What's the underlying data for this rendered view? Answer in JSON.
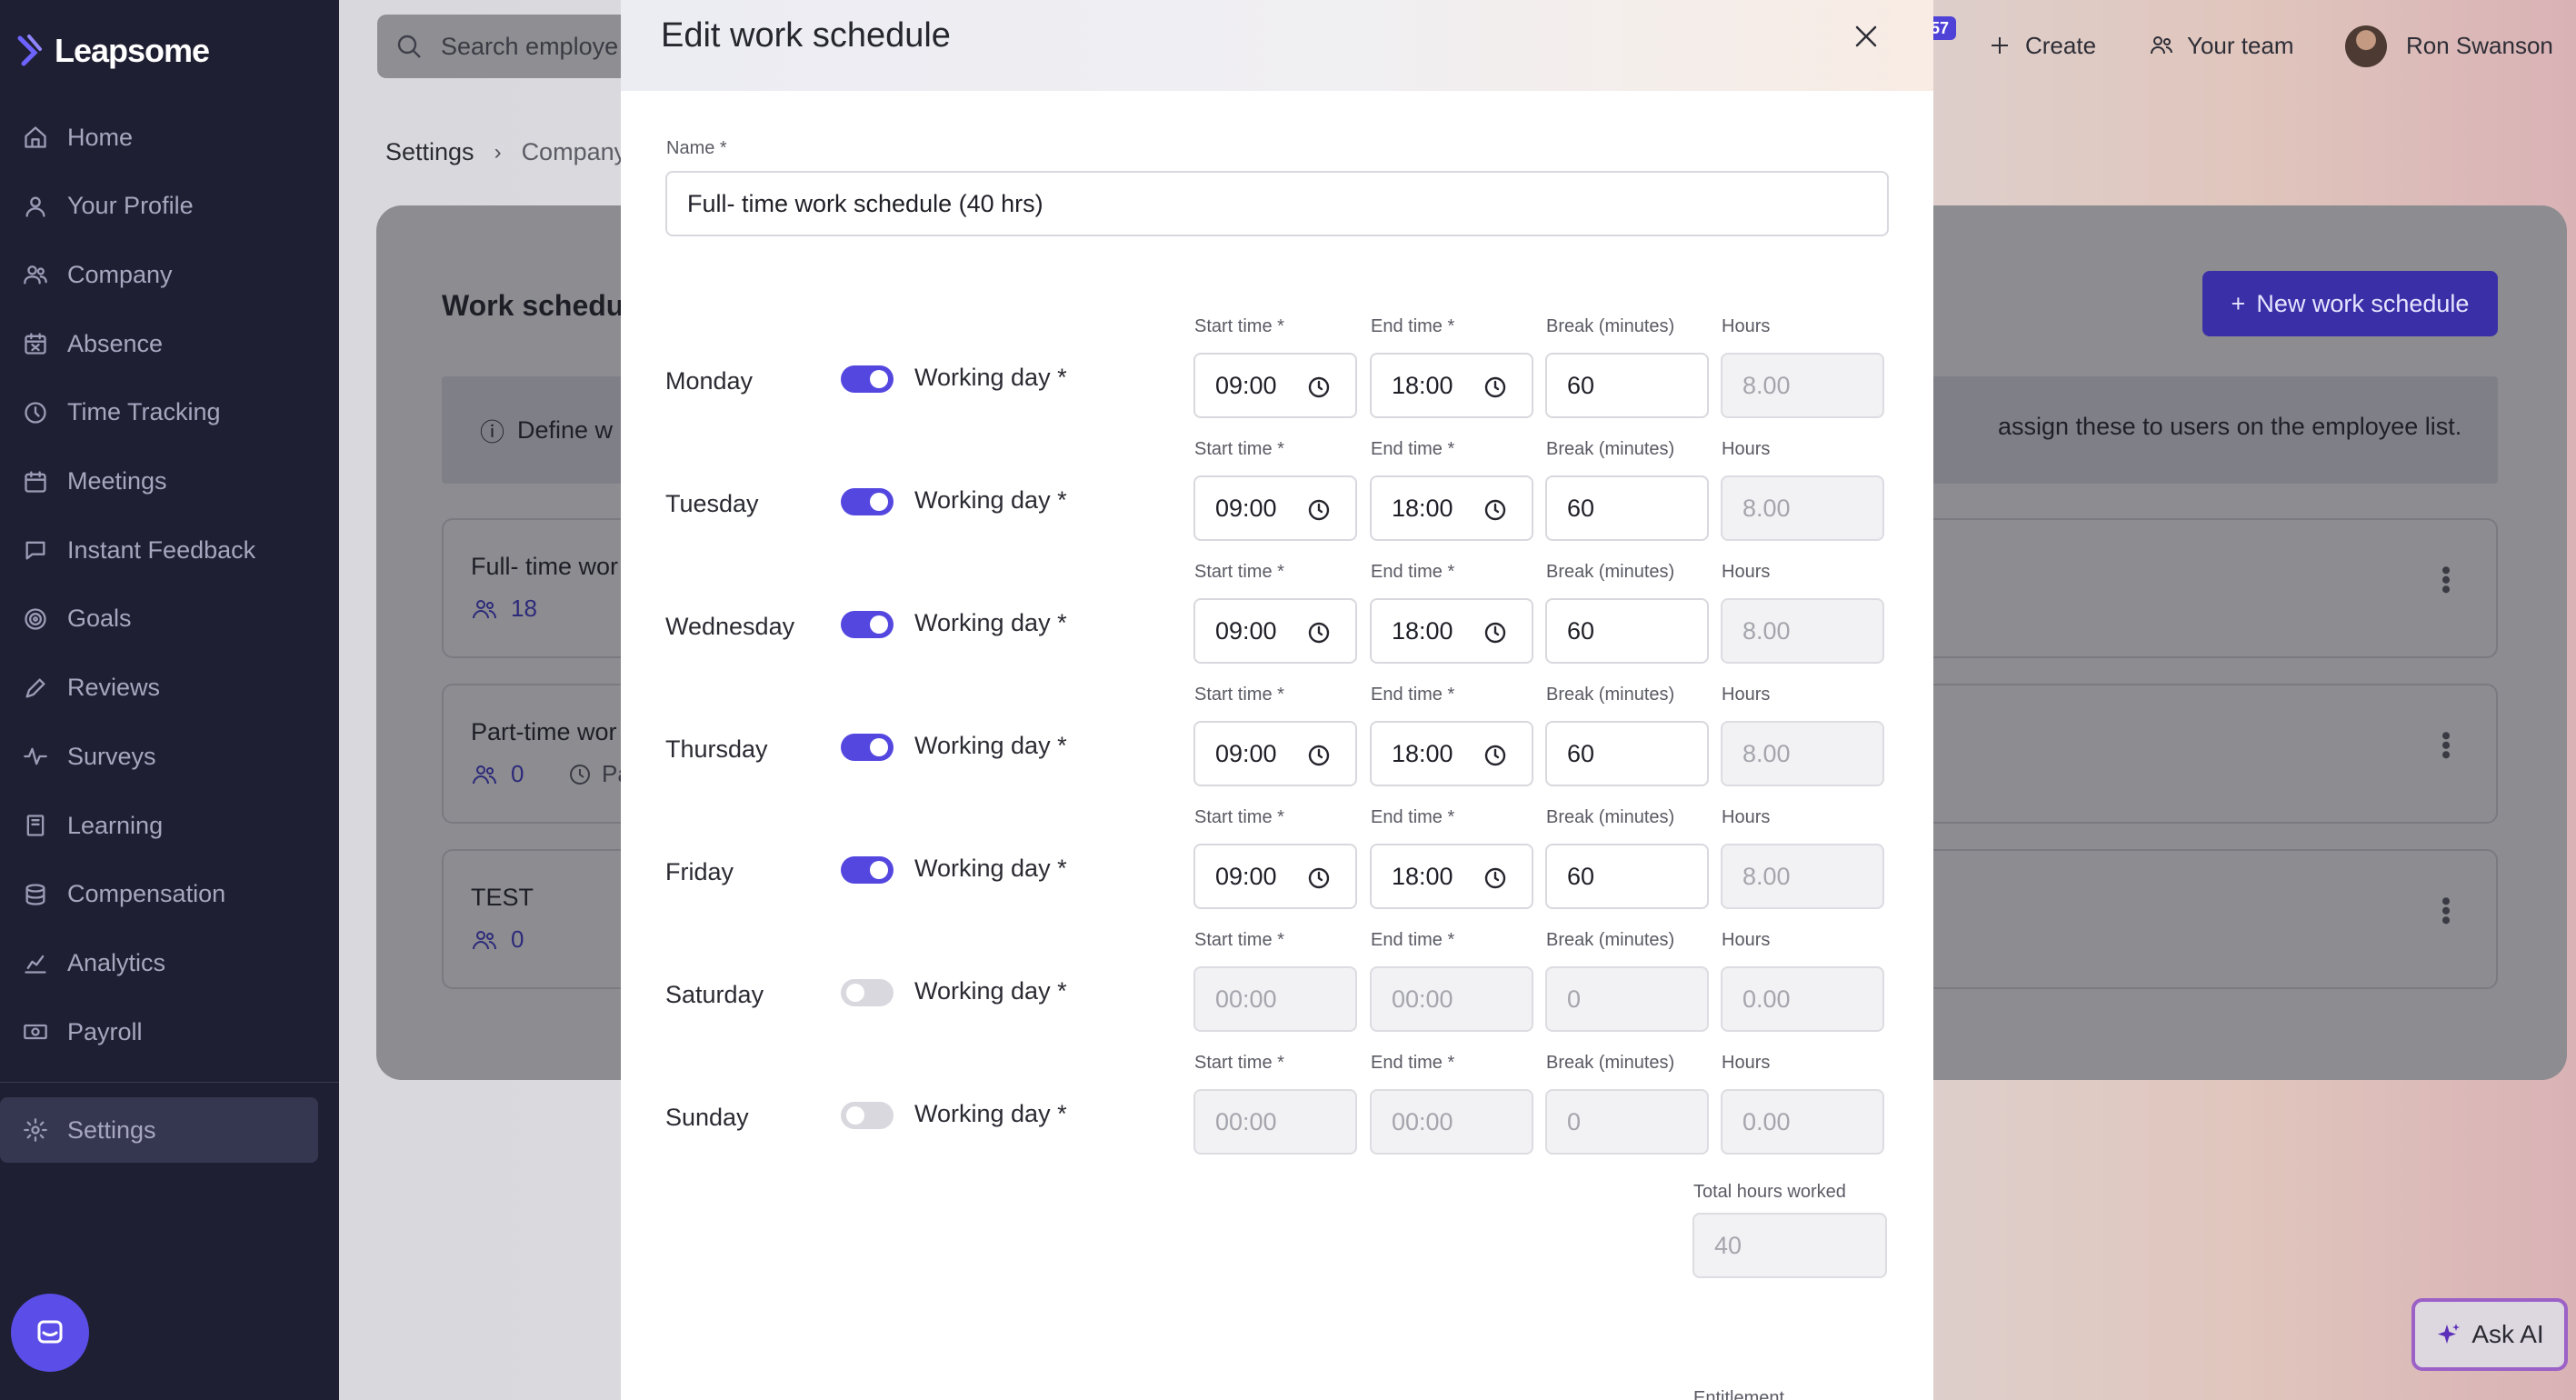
{
  "app": {
    "brand": "Leapsome"
  },
  "sidebar": {
    "items": [
      {
        "label": "Home",
        "icon": "home-icon"
      },
      {
        "label": "Your Profile",
        "icon": "user-icon"
      },
      {
        "label": "Company",
        "icon": "users-icon"
      },
      {
        "label": "Absence",
        "icon": "calendar-x-icon"
      },
      {
        "label": "Time Tracking",
        "icon": "clock-icon"
      },
      {
        "label": "Meetings",
        "icon": "calendar-icon"
      },
      {
        "label": "Instant Feedback",
        "icon": "chat-icon"
      },
      {
        "label": "Goals",
        "icon": "target-icon"
      },
      {
        "label": "Reviews",
        "icon": "pen-icon"
      },
      {
        "label": "Surveys",
        "icon": "pulse-icon"
      },
      {
        "label": "Learning",
        "icon": "book-icon"
      },
      {
        "label": "Compensation",
        "icon": "coins-icon"
      },
      {
        "label": "Analytics",
        "icon": "chart-icon"
      },
      {
        "label": "Payroll",
        "icon": "money-icon"
      }
    ],
    "settings": {
      "label": "Settings",
      "icon": "gear-icon"
    }
  },
  "topbar": {
    "search_placeholder": "Search employe",
    "notifications_count": "57",
    "create_label": "Create",
    "team_label": "Your team",
    "user_name": "Ron Swanson"
  },
  "breadcrumb": {
    "root": "Settings",
    "current": "Company"
  },
  "page": {
    "title": "Work schedu",
    "new_button": "New work schedule",
    "info_left": "Define w",
    "info_right": "assign these to users on the employee list.",
    "cards": [
      {
        "name": "Full- time wor",
        "count": "18",
        "extra": ""
      },
      {
        "name": "Part-time wor",
        "count": "0",
        "extra": "Pa"
      },
      {
        "name": "TEST",
        "count": "0",
        "extra": ""
      }
    ]
  },
  "ask_ai": "Ask AI",
  "modal": {
    "title": "Edit work schedule",
    "name_label": "Name *",
    "name_value": "Full- time work schedule (40 hrs)",
    "labels": {
      "start": "Start time *",
      "end": "End time *",
      "break": "Break (minutes)",
      "hours": "Hours",
      "working_day": "Working day *"
    },
    "days": [
      {
        "name": "Monday",
        "working": true,
        "start": "09:00",
        "end": "18:00",
        "break": "60",
        "hours": "8.00"
      },
      {
        "name": "Tuesday",
        "working": true,
        "start": "09:00",
        "end": "18:00",
        "break": "60",
        "hours": "8.00"
      },
      {
        "name": "Wednesday",
        "working": true,
        "start": "09:00",
        "end": "18:00",
        "break": "60",
        "hours": "8.00"
      },
      {
        "name": "Thursday",
        "working": true,
        "start": "09:00",
        "end": "18:00",
        "break": "60",
        "hours": "8.00"
      },
      {
        "name": "Friday",
        "working": true,
        "start": "09:00",
        "end": "18:00",
        "break": "60",
        "hours": "8.00"
      },
      {
        "name": "Saturday",
        "working": false,
        "start": "00:00",
        "end": "00:00",
        "break": "0",
        "hours": "0.00"
      },
      {
        "name": "Sunday",
        "working": false,
        "start": "00:00",
        "end": "00:00",
        "break": "0",
        "hours": "0.00"
      }
    ],
    "total_label": "Total hours worked",
    "total_value": "40",
    "entitlement_label": "Entitlement"
  },
  "colors": {
    "accent": "#5447e0",
    "sidebar_bg": "#1f1f33",
    "ask_ai_border": "#9b61c7"
  }
}
